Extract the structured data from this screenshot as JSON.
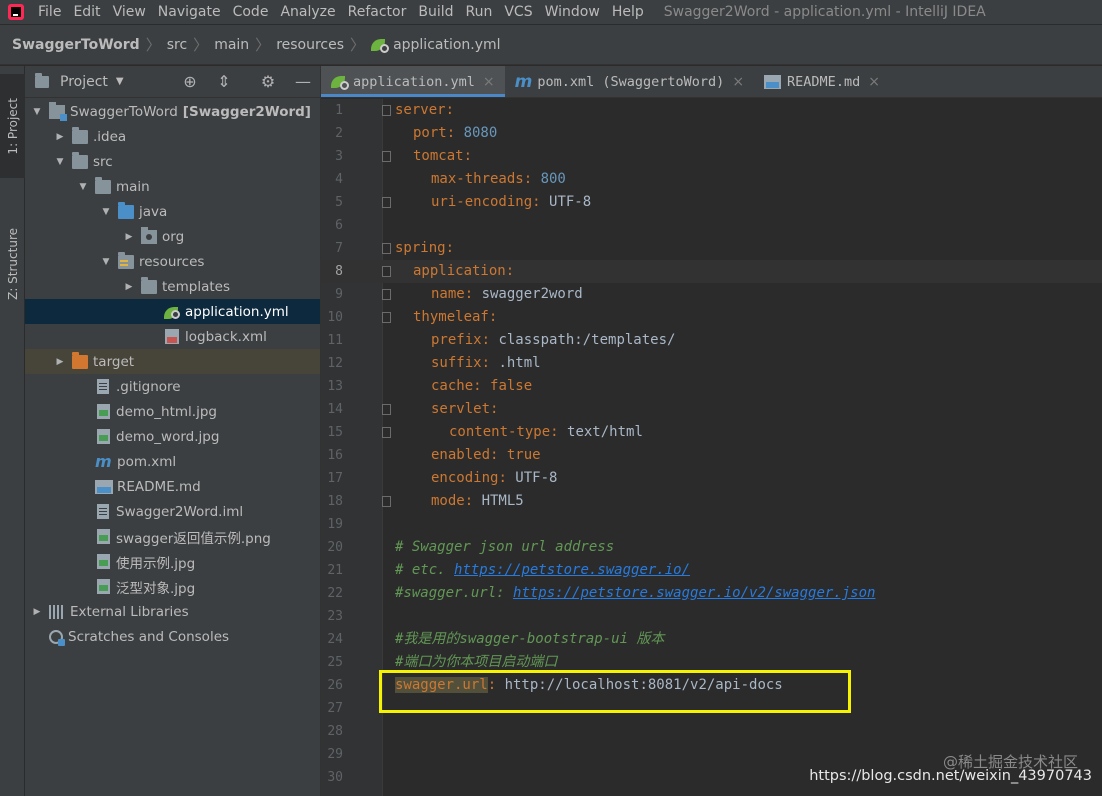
{
  "menubar": {
    "items": [
      "File",
      "Edit",
      "View",
      "Navigate",
      "Code",
      "Analyze",
      "Refactor",
      "Build",
      "Run",
      "VCS",
      "Window",
      "Help"
    ],
    "window_title": "Swagger2Word - application.yml - IntelliJ IDEA"
  },
  "breadcrumb": [
    "SwaggerToWord",
    "src",
    "main",
    "resources",
    "application.yml"
  ],
  "left_strip": {
    "project_tab": "1: Project",
    "structure_tab": "Z: Structure"
  },
  "project_panel": {
    "title": "Project",
    "tree": [
      {
        "label": "SwaggerToWord",
        "extra": "[Swagger2Word]",
        "depth": 0,
        "arrow": "down",
        "icon": "module-folder-icon"
      },
      {
        "label": ".idea",
        "depth": 1,
        "arrow": "right",
        "icon": "folder-icon"
      },
      {
        "label": "src",
        "depth": 1,
        "arrow": "down",
        "icon": "folder-icon"
      },
      {
        "label": "main",
        "depth": 2,
        "arrow": "down",
        "icon": "folder-icon"
      },
      {
        "label": "java",
        "depth": 3,
        "arrow": "down",
        "icon": "source-folder-icon"
      },
      {
        "label": "org",
        "depth": 4,
        "arrow": "right",
        "icon": "package-icon"
      },
      {
        "label": "resources",
        "depth": 3,
        "arrow": "down",
        "icon": "resources-folder-icon"
      },
      {
        "label": "templates",
        "depth": 4,
        "arrow": "right",
        "icon": "folder-icon"
      },
      {
        "label": "application.yml",
        "depth": 5,
        "arrow": "none",
        "icon": "yaml-file-icon",
        "selected": true
      },
      {
        "label": "logback.xml",
        "depth": 5,
        "arrow": "none",
        "icon": "xml-file-icon"
      },
      {
        "label": "target",
        "depth": 1,
        "arrow": "right",
        "icon": "excluded-folder-icon",
        "excluded": true
      },
      {
        "label": ".gitignore",
        "depth": 2,
        "arrow": "none",
        "icon": "text-file-icon"
      },
      {
        "label": "demo_html.jpg",
        "depth": 2,
        "arrow": "none",
        "icon": "image-file-icon"
      },
      {
        "label": "demo_word.jpg",
        "depth": 2,
        "arrow": "none",
        "icon": "image-file-icon"
      },
      {
        "label": "pom.xml",
        "depth": 2,
        "arrow": "none",
        "icon": "maven-icon"
      },
      {
        "label": "README.md",
        "depth": 2,
        "arrow": "none",
        "icon": "markdown-file-icon"
      },
      {
        "label": "Swagger2Word.iml",
        "depth": 2,
        "arrow": "none",
        "icon": "text-file-icon"
      },
      {
        "label": "swagger返回值示例.png",
        "depth": 2,
        "arrow": "none",
        "icon": "image-file-icon"
      },
      {
        "label": "使用示例.jpg",
        "depth": 2,
        "arrow": "none",
        "icon": "image-file-icon"
      },
      {
        "label": "泛型对象.jpg",
        "depth": 2,
        "arrow": "none",
        "icon": "image-file-icon"
      },
      {
        "label": "External Libraries",
        "depth": 0,
        "arrow": "right",
        "icon": "libraries-icon"
      },
      {
        "label": "Scratches and Consoles",
        "depth": 0,
        "arrow": "none",
        "icon": "scratches-icon"
      }
    ]
  },
  "editor_tabs": [
    {
      "label": "application.yml",
      "active": true,
      "icon": "yaml-file-icon"
    },
    {
      "label": "pom.xml (SwaggertoWord)",
      "active": false,
      "icon": "maven-icon"
    },
    {
      "label": "README.md",
      "active": false,
      "icon": "markdown-file-icon"
    }
  ],
  "editor": {
    "current_line": 8,
    "lines": [
      {
        "n": "1",
        "indent": 0,
        "parts": [
          [
            "k",
            "server"
          ],
          [
            "colon",
            ":"
          ]
        ],
        "fold": true
      },
      {
        "n": "2",
        "indent": 1,
        "parts": [
          [
            "k",
            "port"
          ],
          [
            "colon",
            ": "
          ],
          [
            "v",
            "8080"
          ]
        ]
      },
      {
        "n": "3",
        "indent": 1,
        "parts": [
          [
            "k",
            "tomcat"
          ],
          [
            "colon",
            ":"
          ]
        ],
        "fold": true
      },
      {
        "n": "4",
        "indent": 2,
        "parts": [
          [
            "k",
            "max-threads"
          ],
          [
            "colon",
            ": "
          ],
          [
            "v",
            "800"
          ]
        ]
      },
      {
        "n": "5",
        "indent": 2,
        "parts": [
          [
            "k",
            "uri-encoding"
          ],
          [
            "colon",
            ": "
          ],
          [
            "s",
            "UTF-8"
          ]
        ],
        "fold": true
      },
      {
        "n": "6",
        "indent": 0,
        "parts": []
      },
      {
        "n": "7",
        "indent": 0,
        "parts": [
          [
            "k",
            "spring"
          ],
          [
            "colon",
            ":"
          ]
        ],
        "fold": true
      },
      {
        "n": "8",
        "indent": 1,
        "parts": [
          [
            "k",
            "application"
          ],
          [
            "colon",
            ":"
          ]
        ],
        "fold": true
      },
      {
        "n": "9",
        "indent": 2,
        "parts": [
          [
            "k",
            "name"
          ],
          [
            "colon",
            ": "
          ],
          [
            "s",
            "swagger2word"
          ]
        ],
        "fold": true
      },
      {
        "n": "10",
        "indent": 1,
        "parts": [
          [
            "k",
            "thymeleaf"
          ],
          [
            "colon",
            ":"
          ]
        ],
        "fold": true
      },
      {
        "n": "11",
        "indent": 2,
        "parts": [
          [
            "k",
            "prefix"
          ],
          [
            "colon",
            ": "
          ],
          [
            "s",
            "classpath:/templates/"
          ]
        ]
      },
      {
        "n": "12",
        "indent": 2,
        "parts": [
          [
            "k",
            "suffix"
          ],
          [
            "colon",
            ": "
          ],
          [
            "s",
            ".html"
          ]
        ]
      },
      {
        "n": "13",
        "indent": 2,
        "parts": [
          [
            "k",
            "cache"
          ],
          [
            "colon",
            ": "
          ],
          [
            "kw",
            "false"
          ]
        ]
      },
      {
        "n": "14",
        "indent": 2,
        "parts": [
          [
            "k",
            "servlet"
          ],
          [
            "colon",
            ":"
          ]
        ],
        "fold": true
      },
      {
        "n": "15",
        "indent": 3,
        "parts": [
          [
            "k",
            "content-type"
          ],
          [
            "colon",
            ": "
          ],
          [
            "s",
            "text/html"
          ]
        ],
        "fold": true
      },
      {
        "n": "16",
        "indent": 2,
        "parts": [
          [
            "k",
            "enabled"
          ],
          [
            "colon",
            ": "
          ],
          [
            "kw",
            "true"
          ]
        ]
      },
      {
        "n": "17",
        "indent": 2,
        "parts": [
          [
            "k",
            "encoding"
          ],
          [
            "colon",
            ": "
          ],
          [
            "s",
            "UTF-8"
          ]
        ]
      },
      {
        "n": "18",
        "indent": 2,
        "parts": [
          [
            "k",
            "mode"
          ],
          [
            "colon",
            ": "
          ],
          [
            "s",
            "HTML5"
          ]
        ],
        "fold": true
      },
      {
        "n": "19",
        "indent": 0,
        "parts": []
      },
      {
        "n": "20",
        "indent": 0,
        "parts": [
          [
            "cmt",
            "# Swagger json url address"
          ]
        ]
      },
      {
        "n": "21",
        "indent": 0,
        "parts": [
          [
            "cmt",
            "# etc. "
          ],
          [
            "cmt-url",
            "https://petstore.swagger.io/"
          ]
        ]
      },
      {
        "n": "22",
        "indent": 0,
        "parts": [
          [
            "cmt",
            "#swagger.url: "
          ],
          [
            "cmt-url",
            "https://petstore.swagger.io/v2/swagger.json"
          ]
        ]
      },
      {
        "n": "23",
        "indent": 0,
        "parts": []
      },
      {
        "n": "24",
        "indent": 0,
        "parts": [
          [
            "cmt",
            "#我是用的swagger-bootstrap-ui 版本"
          ]
        ]
      },
      {
        "n": "25",
        "indent": 0,
        "parts": [
          [
            "cmt",
            "#端口为你本项目启动端口"
          ]
        ]
      },
      {
        "n": "26",
        "indent": 0,
        "parts": [
          [
            "hl-key",
            "swagger.url"
          ],
          [
            "colon",
            ": "
          ],
          [
            "s",
            "http://localhost:8081/v2/api-docs"
          ]
        ]
      },
      {
        "n": "27",
        "indent": 0,
        "parts": []
      },
      {
        "n": "28",
        "indent": 0,
        "parts": []
      },
      {
        "n": "29",
        "indent": 0,
        "parts": []
      },
      {
        "n": "30",
        "indent": 0,
        "parts": []
      }
    ]
  },
  "watermark": {
    "top": "@稀土掘金技术社区",
    "bottom": "https://blog.csdn.net/weixin_43970743"
  },
  "colors": {
    "background": "#2b2b2b",
    "panel": "#3c3f41",
    "selection": "#0d293e",
    "highlight_box": "#f6f300"
  }
}
